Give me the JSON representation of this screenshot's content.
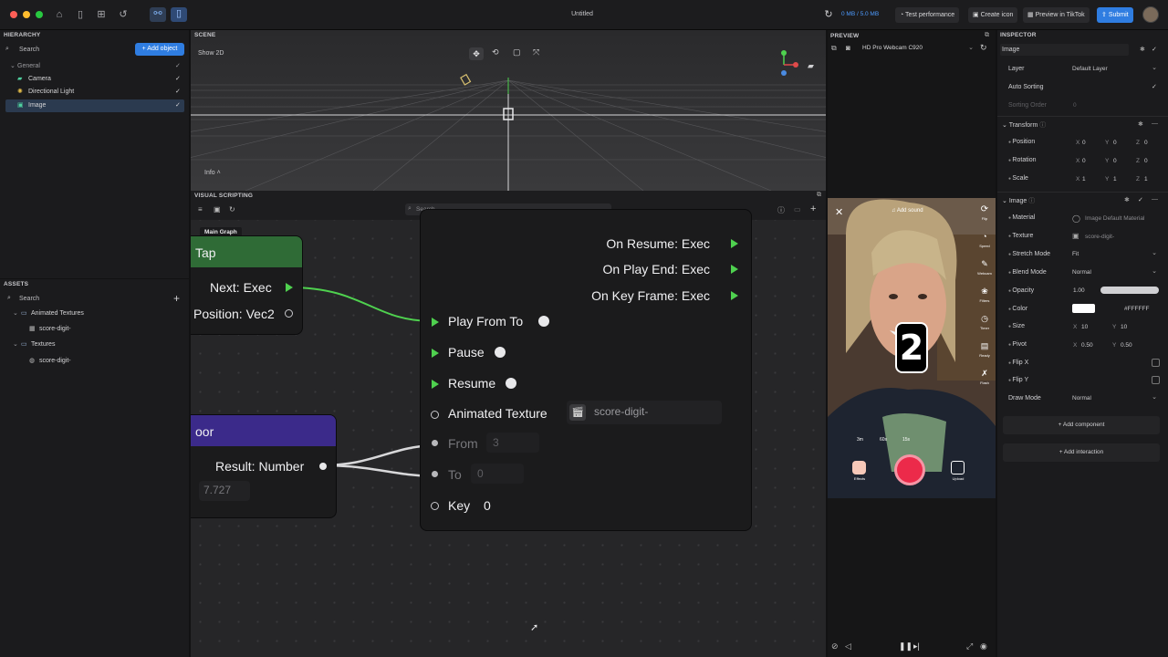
{
  "window": {
    "title": "Untitled"
  },
  "toolbar": {
    "memory": "0 MB / 5.0 MB",
    "test_performance": "Test performance",
    "create_icon": "Create icon",
    "preview_tiktok": "Preview in TikTok",
    "submit": "Submit"
  },
  "hierarchy": {
    "title": "HIERARCHY",
    "search_placeholder": "Search",
    "add_object": "Add object",
    "group": "General",
    "items": [
      {
        "label": "Camera"
      },
      {
        "label": "Directional Light"
      },
      {
        "label": "Image"
      }
    ]
  },
  "assets": {
    "title": "ASSETS",
    "search_placeholder": "Search",
    "folders": [
      {
        "label": "Animated Textures",
        "child": "score-digit-"
      },
      {
        "label": "Textures",
        "child": "score-digit-"
      }
    ]
  },
  "scene": {
    "title": "SCENE",
    "mode": "Show 2D",
    "info": "Info"
  },
  "visual_scripting": {
    "title": "VISUAL SCRIPTING",
    "search_placeholder": "Search",
    "graph_tab": "Main Graph",
    "tap_node": {
      "title": "Tap",
      "next": "Next: Exec",
      "position": "Position: Vec2"
    },
    "floor_node": {
      "title": "oor",
      "result": "Result: Number",
      "value": "7.727"
    },
    "anim_node": {
      "on_resume": "On Resume: Exec",
      "on_play_end": "On Play End: Exec",
      "on_key_frame": "On Key Frame: Exec",
      "play_from_to": "Play From To",
      "pause": "Pause",
      "resume": "Resume",
      "animated_texture": "Animated Texture",
      "texture_value": "score-digit-",
      "from_label": "From",
      "from_value": "3",
      "to_label": "To",
      "to_value": "0",
      "key_label": "Key",
      "key_value": "0"
    }
  },
  "preview": {
    "title": "PREVIEW",
    "camera": "HD Pro Webcam C920",
    "add_sound": "Add sound",
    "digit": "2",
    "durations": [
      "3m",
      "60s",
      "15s"
    ],
    "side_labels": [
      "Flip",
      "Speed",
      "Webcam",
      "Filters",
      "Timer",
      "Ready",
      "Flash"
    ],
    "effects": "Effects",
    "upload": "Upload"
  },
  "inspector": {
    "title": "INSPECTOR",
    "name": "Image",
    "layer_label": "Layer",
    "layer_value": "Default Layer",
    "auto_sorting": "Auto Sorting",
    "sorting_order_label": "Sorting Order",
    "sorting_order_value": "0",
    "transform": "Transform",
    "position": {
      "label": "Position",
      "x": "0",
      "y": "0",
      "z": "0"
    },
    "rotation": {
      "label": "Rotation",
      "x": "0",
      "y": "0",
      "z": "0"
    },
    "scale": {
      "label": "Scale",
      "x": "1",
      "y": "1",
      "z": "1"
    },
    "image_section": "Image",
    "material_label": "Material",
    "material_value": "Image Default Material",
    "texture_label": "Texture",
    "texture_value": "score-digit-",
    "stretch_label": "Stretch Mode",
    "stretch_value": "Fit",
    "blend_label": "Blend Mode",
    "blend_value": "Normal",
    "opacity_label": "Opacity",
    "opacity_value": "1.00",
    "opacity_level": 1.0,
    "color_label": "Color",
    "color_hex": "#FFFFFF",
    "size": {
      "label": "Size",
      "x": "10",
      "y": "10"
    },
    "pivot": {
      "label": "Pivot",
      "x": "0.50",
      "y": "0.50"
    },
    "flip_x": "Flip X",
    "flip_y": "Flip Y",
    "draw_mode_label": "Draw Mode",
    "draw_mode_value": "Normal",
    "add_component": "+ Add component",
    "add_interaction": "+ Add interaction"
  },
  "colors": {
    "accent": "#2f7de1",
    "exec_green": "#4fd14f",
    "tap_header": "#2f6b36",
    "floor_header": "#3b2a8a"
  }
}
